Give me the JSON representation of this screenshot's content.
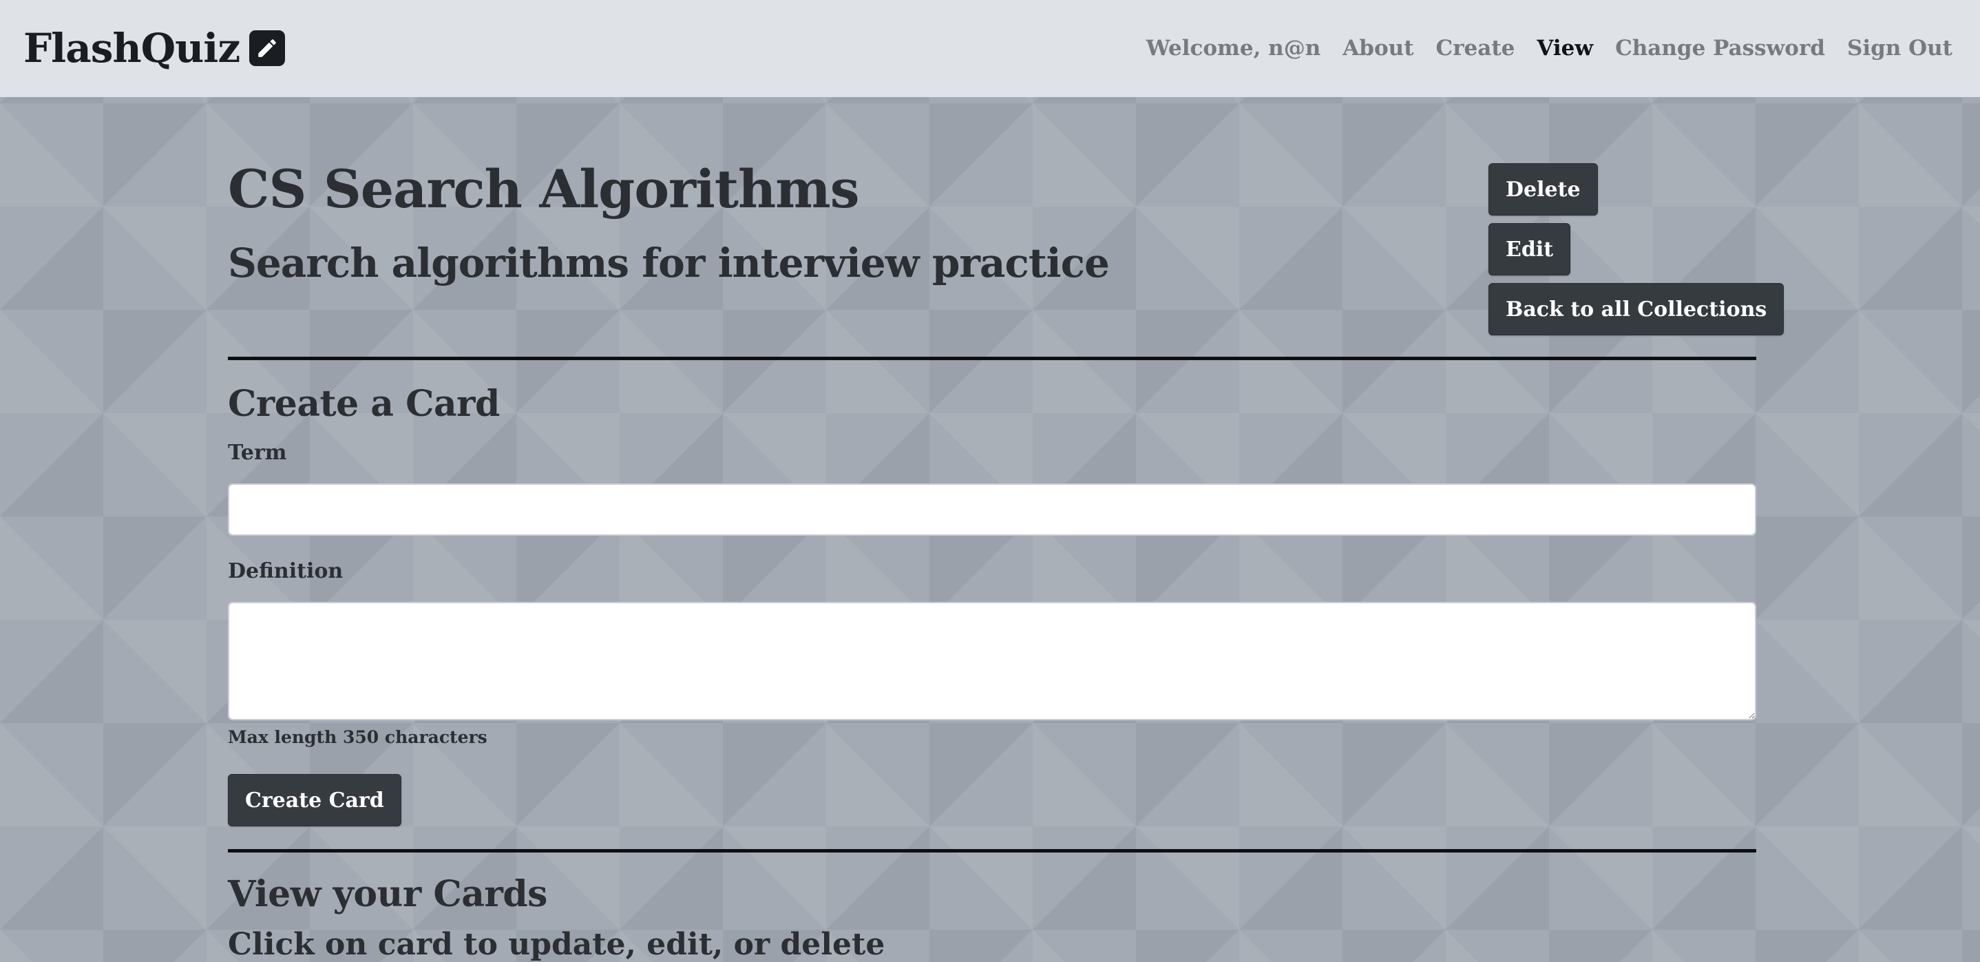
{
  "app": {
    "brand": "FlashQuiz",
    "brand_icon": "pencil-icon"
  },
  "nav": {
    "welcome": "Welcome, n@n",
    "about": "About",
    "create": "Create",
    "view": "View",
    "change_password": "Change Password",
    "sign_out": "Sign Out",
    "active": "View"
  },
  "collection": {
    "title": "CS Search Algorithms",
    "description": "Search algorithms for interview practice"
  },
  "actions": {
    "delete": "Delete",
    "edit": "Edit",
    "back": "Back to all Collections"
  },
  "create_card": {
    "heading": "Create a Card",
    "term_label": "Term",
    "term_value": "",
    "definition_label": "Definition",
    "definition_value": "",
    "hint": "Max length 350 characters",
    "submit": "Create Card"
  },
  "view_cards": {
    "heading": "View your Cards",
    "subheading": "Click on card to update, edit, or delete"
  },
  "colors": {
    "navbar_bg": "#dfe2e6",
    "page_bg": "#a3aab3",
    "button_bg": "#363b40",
    "text": "#2b2f33"
  }
}
